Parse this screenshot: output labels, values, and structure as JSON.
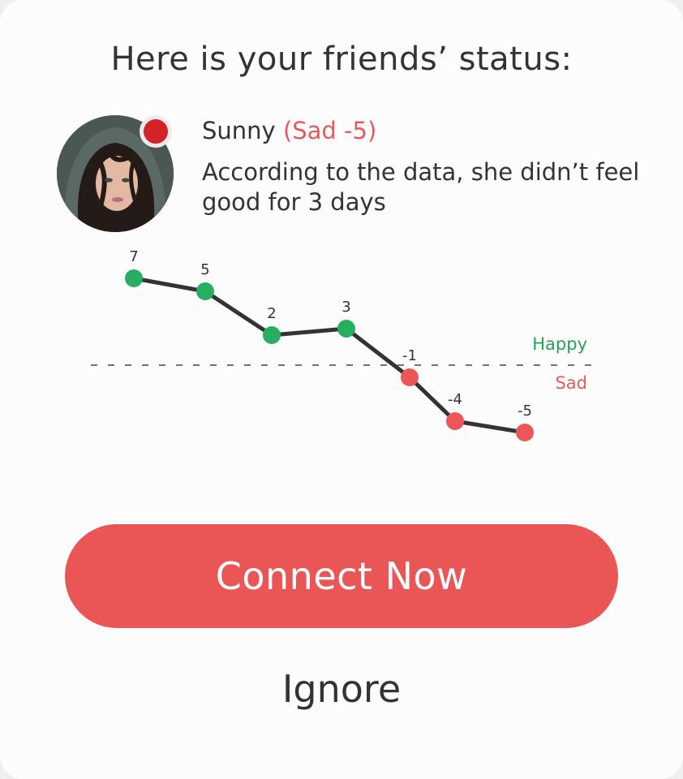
{
  "header": {
    "title": "Here is your friends’ status:"
  },
  "friend": {
    "name": "Sunny",
    "mood_label": "(Sad -5)",
    "description": "According to the data, she didn’t feel good for 3 days",
    "status_color": "#d32228"
  },
  "chart_data": {
    "type": "line",
    "values": [
      7,
      5,
      2,
      3,
      -1,
      -4,
      -5
    ],
    "labels": [
      "7",
      "5",
      "2",
      "3",
      "-1",
      "-4",
      "-5"
    ],
    "threshold": 0,
    "threshold_labels": {
      "above": "Happy",
      "below": "Sad"
    },
    "colors": {
      "positive": "#27ae60",
      "negative": "#eb5757",
      "line": "#333333"
    },
    "grid": false
  },
  "actions": {
    "connect_label": "Connect Now",
    "ignore_label": "Ignore"
  },
  "colors": {
    "accent": "#ea5656",
    "text": "#333333",
    "happy": "#27a25a",
    "sad": "#e85a5a"
  }
}
